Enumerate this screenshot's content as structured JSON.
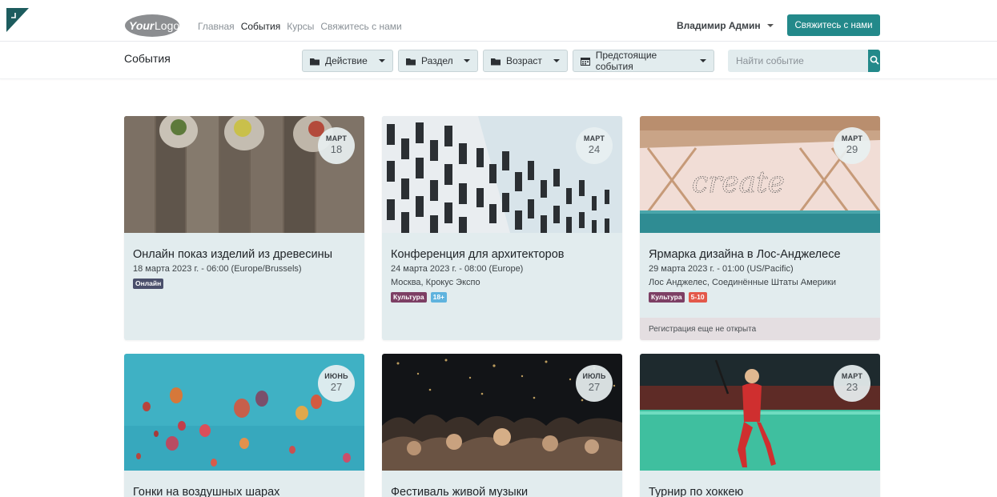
{
  "logo": {
    "text": "YourLogo"
  },
  "nav": {
    "links": [
      "Главная",
      "События",
      "Курсы",
      "Свяжитесь с нами"
    ]
  },
  "user": {
    "name": "Владимир Админ"
  },
  "contact_button": "Свяжитесь с нами",
  "subheader": {
    "title": "События",
    "filters": [
      "Действие",
      "Раздел",
      "Возраст",
      "Предстоящие события"
    ],
    "search_placeholder": "Найти событие"
  },
  "events": [
    {
      "month": "МАРТ",
      "day": "18",
      "title": "Онлайн показ изделий из древесины",
      "date": "18 марта 2023 г. - 06:00 (Europe/Brussels)",
      "location": "",
      "tags": [
        {
          "label": "Онлайн",
          "color": "#4a4f6b"
        }
      ],
      "footer": ""
    },
    {
      "month": "МАРТ",
      "day": "24",
      "title": "Конференция для архитекторов",
      "date": "24 марта 2023 г. - 08:00 (Europe)",
      "location": "Москва, Крокус Экспо",
      "tags": [
        {
          "label": "Культура",
          "color": "#7d3f64"
        },
        {
          "label": "18+",
          "color": "#5fb3de"
        }
      ],
      "footer": ""
    },
    {
      "month": "МАРТ",
      "day": "29",
      "title": "Ярмарка дизайна в Лос-Анджелесе",
      "date": "29 марта 2023 г. - 01:00 (US/Pacific)",
      "location": "Лос Анджелес, Соединённые Штаты Америки",
      "tags": [
        {
          "label": "Культура",
          "color": "#7d3f64"
        },
        {
          "label": "5-10",
          "color": "#e3584a"
        }
      ],
      "footer": "Регистрация еще не открыта"
    },
    {
      "month": "ИЮНЬ",
      "day": "27",
      "title": "Гонки на воздушных шарах",
      "date": "",
      "location": "",
      "tags": [],
      "footer": ""
    },
    {
      "month": "ИЮЛЬ",
      "day": "27",
      "title": "Фестиваль живой музыки",
      "date": "",
      "location": "",
      "tags": [],
      "footer": ""
    },
    {
      "month": "МАРТ",
      "day": "23",
      "title": "Турнир по хоккею",
      "date": "",
      "location": "",
      "tags": [],
      "footer": ""
    }
  ]
}
